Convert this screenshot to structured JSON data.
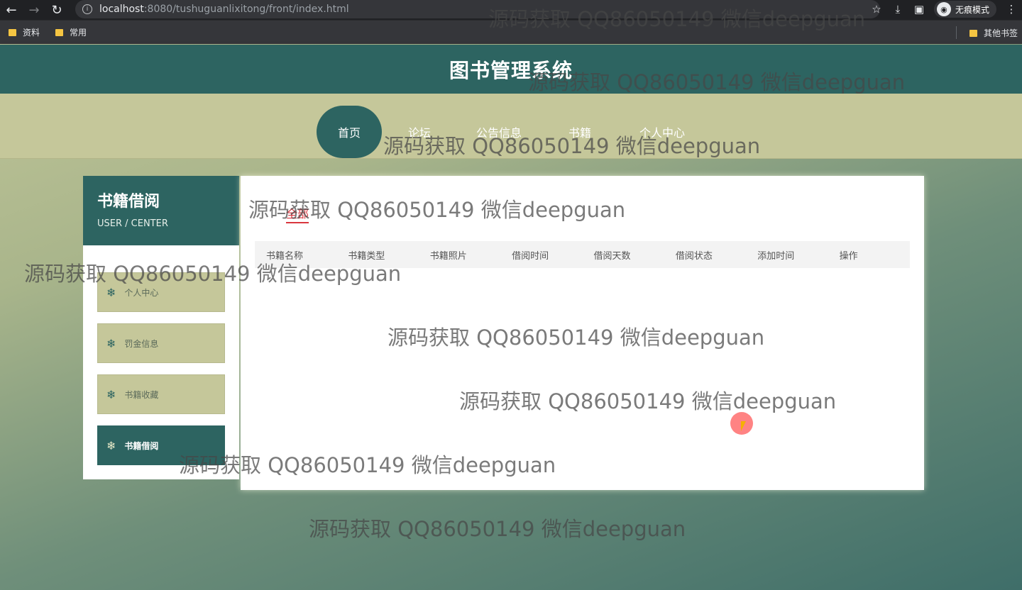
{
  "browser": {
    "url_host": "localhost",
    "url_rest": ":8080/tushuguanlixitong/front/index.html",
    "incognito_label": "无痕模式",
    "bookmarks": [
      "资料",
      "常用"
    ],
    "other_bookmarks": "其他书签"
  },
  "site": {
    "title": "图书管理系统",
    "nav": [
      "首页",
      "论坛",
      "公告信息",
      "书籍",
      "个人中心"
    ]
  },
  "sidebar": {
    "title": "书籍借阅",
    "subtitle": "USER / CENTER",
    "items": [
      {
        "label": "个人中心",
        "active": false
      },
      {
        "label": "罚金信息",
        "active": false
      },
      {
        "label": "书籍收藏",
        "active": false
      },
      {
        "label": "书籍借阅",
        "active": true
      }
    ]
  },
  "panel": {
    "tab": "全部",
    "columns": [
      "书籍名称",
      "书籍类型",
      "书籍照片",
      "借阅时间",
      "借阅天数",
      "借阅状态",
      "添加时间",
      "操作"
    ]
  },
  "watermark_text": "源码获取 QQ86050149 微信deepguan",
  "colors": {
    "primary": "#2d6461",
    "secondary": "#c5c79a",
    "tab_accent": "#d9363e"
  }
}
